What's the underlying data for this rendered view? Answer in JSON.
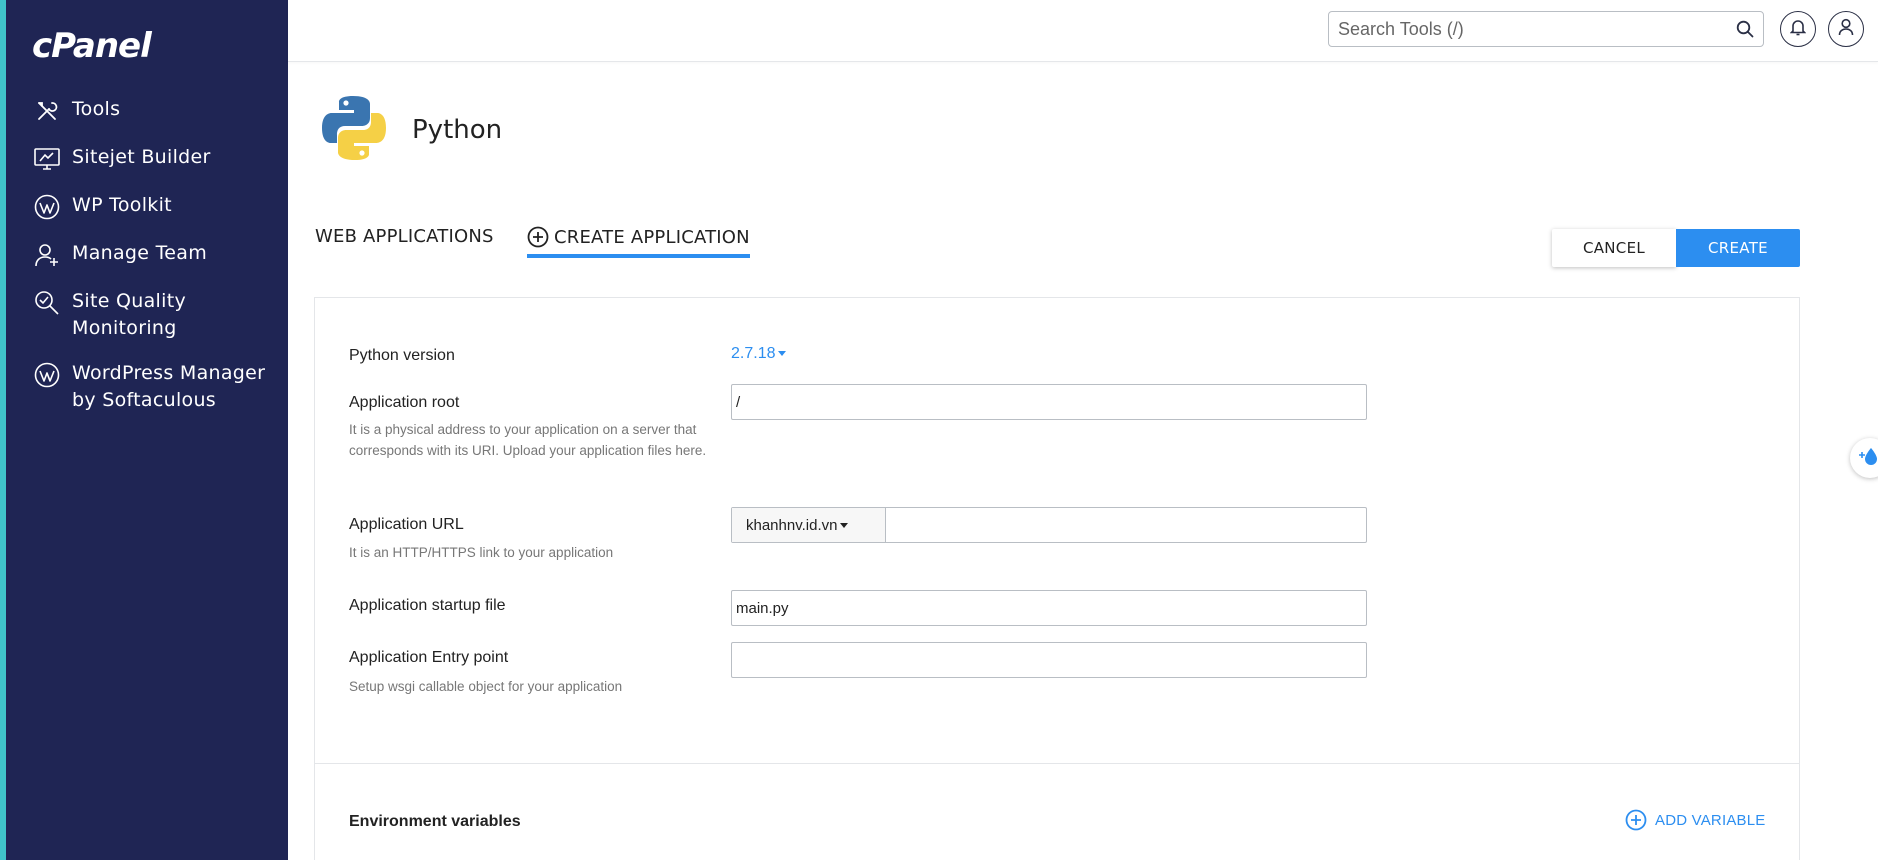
{
  "sidebar": {
    "logo": "cPanel",
    "items": [
      {
        "label": "Tools",
        "icon": "tools-icon"
      },
      {
        "label": "Sitejet Builder",
        "icon": "monitor-builder-icon"
      },
      {
        "label": "WP Toolkit",
        "icon": "wordpress-icon"
      },
      {
        "label": "Manage Team",
        "icon": "user-add-icon"
      },
      {
        "label": "Site Quality Monitoring",
        "icon": "magnifier-check-icon"
      },
      {
        "label": "WordPress Manager by Softaculous",
        "icon": "wordpress-icon"
      }
    ]
  },
  "header": {
    "search_placeholder": "Search Tools (/)",
    "notifications_icon": "bell-icon",
    "user_icon": "user-icon"
  },
  "page": {
    "title": "Python",
    "logo_icon": "python-logo-icon"
  },
  "tabs": {
    "web_applications": "WEB APPLICATIONS",
    "create_application": "CREATE APPLICATION"
  },
  "actions": {
    "cancel": "CANCEL",
    "create": "CREATE"
  },
  "form": {
    "python_version": {
      "label": "Python version",
      "value": "2.7.18"
    },
    "app_root": {
      "label": "Application root",
      "help": "It is a physical address to your application on a server that corresponds with its URI. Upload your application files here.",
      "value": "/"
    },
    "app_url": {
      "label": "Application URL",
      "help": "It is an HTTP/HTTPS link to your application",
      "domain": "khanhnv.id.vn",
      "path": ""
    },
    "startup_file": {
      "label": "Application startup file",
      "value": "main.py"
    },
    "entry_point": {
      "label": "Application Entry point",
      "help": "Setup wsgi callable object for your application",
      "value": ""
    }
  },
  "env": {
    "title": "Environment variables",
    "add_label": "ADD VARIABLE"
  },
  "colors": {
    "sidebar_bg": "#1f2554",
    "accent": "#2c8ef0",
    "strip": "#40c4c9"
  }
}
